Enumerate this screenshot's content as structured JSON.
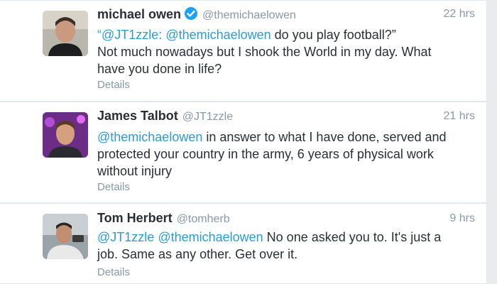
{
  "tweets": [
    {
      "name": "michael owen",
      "verified": true,
      "handle": "@themichaelowen",
      "time": "22 hrs",
      "quote_mention1": "“@JT1zzle:",
      "quote_mention2": "@themichaelowen",
      "quote_rest": " do you play football?”",
      "body": "Not much nowadays but I shook the World in my day. What have you done in life?",
      "details_label": "Details"
    },
    {
      "name": "James Talbot",
      "handle": "@JT1zzle",
      "time": "21 hrs",
      "mention": "@themichaelowen",
      "body": " in answer to what I have done, served and protected your country in the army, 6 years of physical work without injury",
      "details_label": "Details"
    },
    {
      "name": "Tom Herbert",
      "handle": "@tomherb",
      "time": "9 hrs",
      "mention1": "@JT1zzle",
      "mention2": "@themichaelowen",
      "body": " No one asked you to. It's just a job. Same as any other. Get over it.",
      "details_label": "Details"
    }
  ],
  "colors": {
    "mention": "#2b9bd6",
    "verified": "#1da1f2",
    "muted": "#8899a6",
    "text": "#292f33"
  }
}
